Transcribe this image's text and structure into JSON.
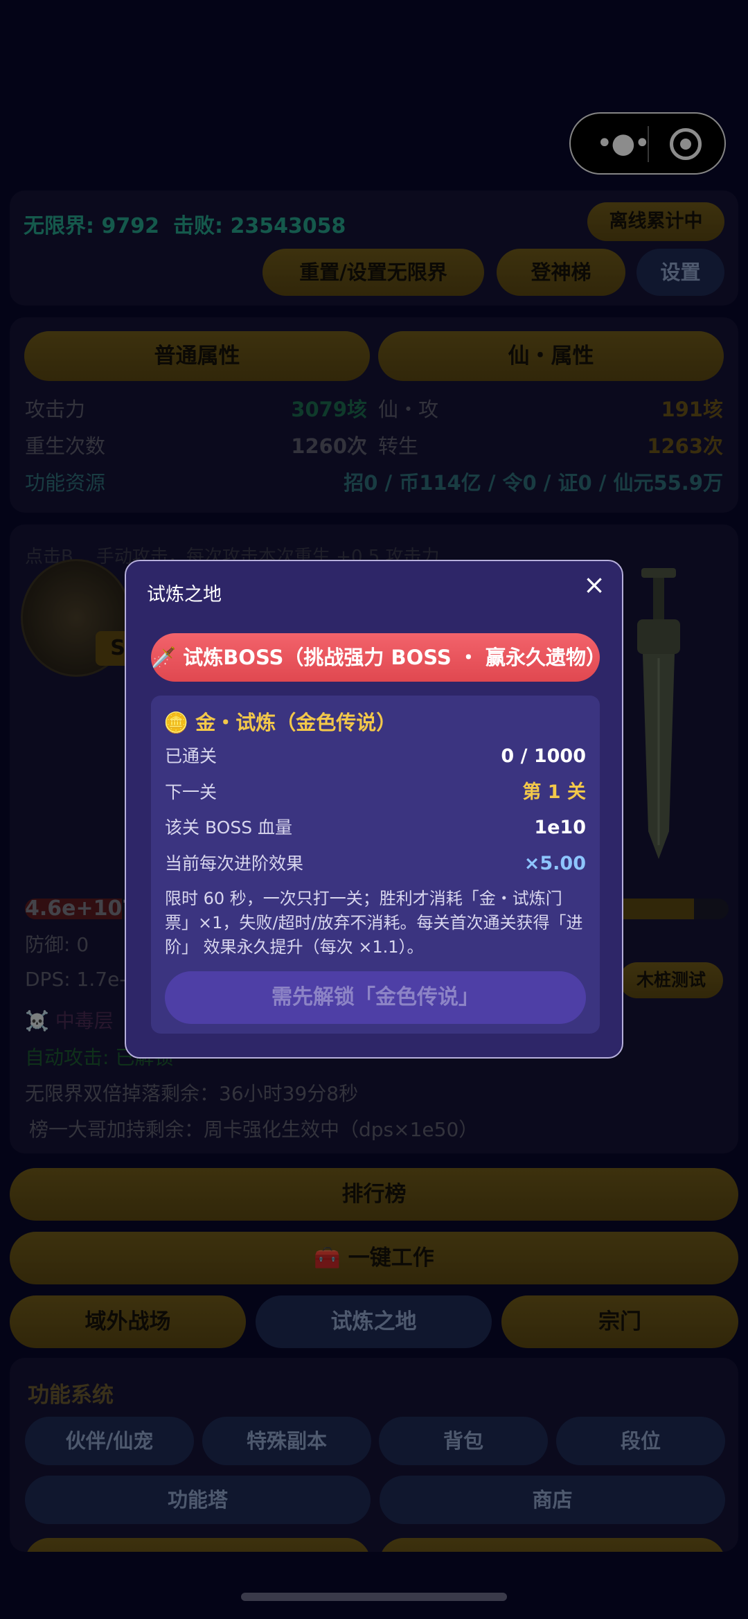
{
  "top": {
    "infinite": "无限界: 9792",
    "defeats": "击败: 23543058",
    "offline": "离线累计中",
    "btn_reset": "重置/设置无限界",
    "btn_ladder": "登神梯",
    "btn_settings": "设置"
  },
  "attrs": {
    "tab_normal": "普通属性",
    "tab_immortal": "仙・属性",
    "rows": [
      {
        "k1": "攻击力",
        "v1": "3079垓",
        "k2": "仙・攻",
        "v2": "191垓"
      },
      {
        "k1": "重生次数",
        "v1": "1260次",
        "k2": "转生",
        "v2": "1263次"
      }
    ],
    "res_label": "功能资源",
    "res_value": "招0 / 币114亿 / 令0 / 证0 / 仙元55.9万"
  },
  "battle": {
    "hint": "点击B... 手动攻击，每次攻击本次重生 +0.5 攻击力",
    "badge": "S",
    "hp": "4.6e+107",
    "defense": "防御: 0",
    "dps": "DPS: 1.7e-",
    "poison": "中毒层",
    "auto": "自动攻击: 已解锁",
    "double_drop": "无限界双倍掉落剩余：36小时39分8秒",
    "leader": "榜一大哥加持剩余：周卡强化生效中（dps×1e50）",
    "dummy_btn": "木桩测试"
  },
  "main_buttons": {
    "ranking": "排行榜",
    "one_key": "一键工作",
    "outer": "域外战场",
    "trial": "试炼之地",
    "sect": "宗门"
  },
  "func": {
    "title": "功能系统",
    "items": [
      "伙伴/仙宠",
      "特殊副本",
      "背包",
      "段位",
      "功能塔",
      "商店"
    ]
  },
  "modal": {
    "title": "试炼之地",
    "close": "×",
    "banner": "🗡️ 试炼BOSS（挑战强力 BOSS ・ 赢永久遗物）",
    "section_title": "🪙 金・试炼（金色传说）",
    "rows": [
      {
        "label": "已通关",
        "value": "0 / 1000"
      },
      {
        "label": "下一关",
        "value": "第 1 关"
      },
      {
        "label": "该关 BOSS 血量",
        "value": "1e10"
      },
      {
        "label": "当前每次进阶效果",
        "value": "×5.00"
      }
    ],
    "desc": "限时 60 秒，一次只打一关；胜利才消耗「金・试炼门票」×1，失败/超时/放弃不消耗。每关首次通关获得「进阶」 效果永久提升（每次 ×1.1）。",
    "unlock": "需先解锁「金色传说」"
  },
  "colors": {
    "gold": "#e8b93a",
    "teal": "#27a38a",
    "red": "#e04850",
    "blue": "#8ec6ff"
  }
}
